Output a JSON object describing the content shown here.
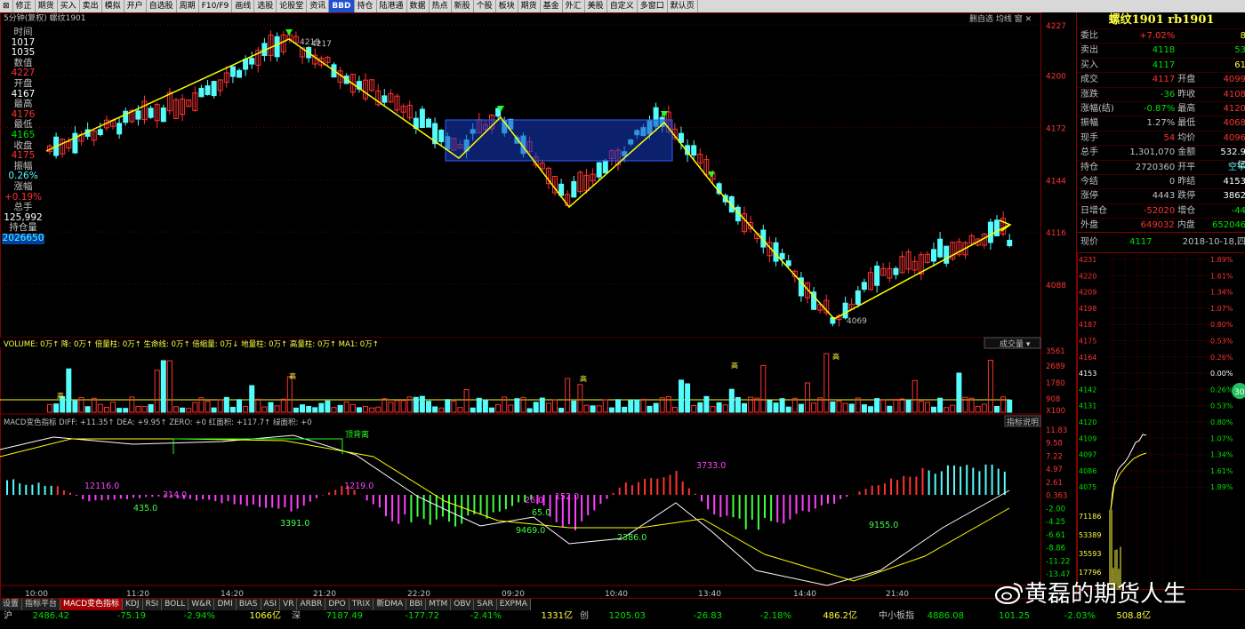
{
  "menu": [
    "⊠",
    "修正",
    "期货",
    "买入",
    "卖出",
    "模拟",
    "开户",
    "自选股",
    "周期",
    "F10/F9",
    "画线",
    "选股",
    "论股堂",
    "资讯",
    "BBD",
    "持仓",
    "陆港通",
    "数据",
    "热点",
    "新股",
    "个股",
    "板块",
    "期货",
    "基金",
    "外汇",
    "美股",
    "自定义",
    "多窗口",
    "默认页"
  ],
  "chart": {
    "header": "5分钟(复权)  螺纹1901",
    "tools": "删自选  均线  窗  ✕",
    "price_ticks": [
      "4227",
      "4200",
      "4172",
      "4144",
      "4116",
      "4088"
    ],
    "volume_ticks": [
      "3561",
      "2689",
      "1780",
      "908",
      "X100"
    ],
    "macd_ticks": [
      "11.83",
      "9.58",
      "7.22",
      "4.97",
      "2.61",
      "0.363",
      "-2.00",
      "-4.25",
      "-6.61",
      "-8.86",
      "-11.22",
      "-13.47"
    ],
    "time_labels": [
      "10:00",
      "11:20",
      "14:20",
      "21:20",
      "22:20",
      "09:20",
      "10:40",
      "13:40",
      "14:40",
      "21:40"
    ],
    "annotations": {
      "high": "4219",
      "high2": "4217",
      "low": "4069"
    },
    "volume_legend": "VOLUME: 0万↑  降: 0万↑  倍量柱: 0万↑  生命线: 0万↑  倍缩量: 0万↓  地量柱: 0万↑  高量柱: 0万↑  MA1: 0万↑",
    "volume_selector": "成交量",
    "macd_legend": "MACD变色指标  DIFF: +11.35↑  DEA: +9.95↑  ZERO: +0  红面积: +117.7↑  绿面积: +0",
    "macd_help": "指标说明",
    "macd_top_label": "顶背离",
    "macd_labels": [
      "12116.0",
      "435.0",
      "314.0",
      "3391.0",
      "1219.0",
      "26.0",
      "152.0",
      "65.0",
      "9469.0",
      "2386.0",
      "3733.0",
      "9155.0"
    ],
    "vol_mark": "高"
  },
  "info_panel": [
    {
      "label": "时间",
      "value": "1017"
    },
    {
      "label": "",
      "value": "1035"
    },
    {
      "label": "数值",
      "value": "4227"
    },
    {
      "label": "开盘",
      "value": "4167"
    },
    {
      "label": "最高",
      "value": "4176"
    },
    {
      "label": "最低",
      "value": "4165"
    },
    {
      "label": "收盘",
      "value": "4175"
    },
    {
      "label": "振幅",
      "value": "0.26%"
    },
    {
      "label": "涨幅",
      "value": "+0.19%"
    },
    {
      "label": "总手",
      "value": "125,992"
    },
    {
      "label": "持仓量",
      "value": "2026650"
    }
  ],
  "quote": {
    "title": "螺纹1901 rb1901",
    "rows": [
      [
        "委比",
        "+7.02%",
        "",
        "8"
      ],
      [
        "卖出",
        "4118",
        "",
        "53"
      ],
      [
        "买入",
        "4117",
        "",
        "61"
      ],
      [
        "成交",
        "4117",
        "开盘",
        "4099"
      ],
      [
        "涨跌",
        "-36",
        "昨收",
        "4108"
      ],
      [
        "涨幅(结)",
        "-0.87%",
        "最高",
        "4120"
      ],
      [
        "振幅",
        "1.27%",
        "最低",
        "4068"
      ],
      [
        "现手",
        "54",
        "均价",
        "4096"
      ],
      [
        "总手",
        "1,301,070",
        "金额",
        "532.9亿"
      ],
      [
        "持仓",
        "2720360",
        "开平",
        "空平"
      ],
      [
        "今结",
        "0",
        "昨结",
        "4153"
      ],
      [
        "涨停",
        "4443",
        "跌停",
        "3862"
      ],
      [
        "日增仓",
        "-52020",
        "增仓",
        "-44"
      ],
      [
        "外盘",
        "649032",
        "内盘",
        "652046"
      ]
    ],
    "current_label": "现价",
    "current_value": "4117",
    "date": "2018-10-18,四",
    "mini_prices": [
      "4231",
      "4220",
      "4209",
      "4198",
      "4187",
      "4175",
      "4164",
      "4153",
      "4142",
      "4131",
      "4120",
      "4109",
      "4097",
      "4086",
      "4075"
    ],
    "mini_pcts": [
      "1.89%",
      "1.61%",
      "1.34%",
      "1.07%",
      "0.80%",
      "0.53%",
      "0.26%",
      "0.00%",
      "0.26%",
      "0.53%",
      "0.80%",
      "1.07%",
      "1.34%",
      "1.61%",
      "1.89%"
    ],
    "mini_vol": [
      "71186",
      "53389",
      "35593",
      "17796"
    ],
    "badge": "30"
  },
  "tabs": [
    "设置",
    "指标平台",
    "MACD变色指标",
    "KDJ",
    "RSI",
    "BOLL",
    "W&R",
    "DMI",
    "BIAS",
    "ASI",
    "VR",
    "ARBR",
    "DPO",
    "TRIX",
    "新DMA",
    "BBI",
    "MTM",
    "OBV",
    "SAR",
    "EXPMA"
  ],
  "index_bar": [
    {
      "t": "沪",
      "c": "#c0c0c0"
    },
    {
      "t": "2486.42",
      "c": "#00e000"
    },
    {
      "t": "-75.19",
      "c": "#00e000"
    },
    {
      "t": "-2.94%",
      "c": "#00e000"
    },
    {
      "t": "1066亿",
      "c": "#ffff40"
    },
    {
      "t": "深",
      "c": "#c0c0c0"
    },
    {
      "t": "7187.49",
      "c": "#00e000"
    },
    {
      "t": "-177.72",
      "c": "#00e000"
    },
    {
      "t": "-2.41%",
      "c": "#00e000"
    },
    {
      "t": "1331亿",
      "c": "#ffff40"
    },
    {
      "t": "创",
      "c": "#c0c0c0"
    },
    {
      "t": "1205.03",
      "c": "#00e000"
    },
    {
      "t": "-26.83",
      "c": "#00e000"
    },
    {
      "t": "-2.18%",
      "c": "#00e000"
    },
    {
      "t": "486.2亿",
      "c": "#ffff40"
    },
    {
      "t": "中小板指",
      "c": "#c0c0c0"
    },
    {
      "t": "4886.08",
      "c": "#00e000"
    },
    {
      "t": "101.25",
      "c": "#00e000"
    },
    {
      "t": "-2.03%",
      "c": "#00e000"
    },
    {
      "t": "508.8亿",
      "c": "#ffff40"
    }
  ],
  "watermark": "黄磊的期货人生",
  "colors": {
    "up": "#ff3232",
    "down": "#54fcfc",
    "line": "#ffff00",
    "grid": "#800000",
    "text": "#c0c0c0"
  }
}
